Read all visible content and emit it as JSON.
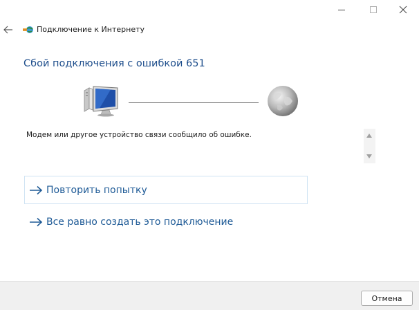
{
  "window": {
    "title": "Подключение к Интернету"
  },
  "heading": "Сбой подключения с ошибкой 651",
  "message": "Модем или другое устройство связи сообщило об ошибке.",
  "options": [
    {
      "label": "Повторить попытку"
    },
    {
      "label": "Все равно создать это подключение"
    }
  ],
  "footer": {
    "cancel_label": "Отмена"
  },
  "colors": {
    "heading": "#1e4e8c",
    "link": "#1e5a96",
    "accent_border": "#cfe3f3"
  },
  "icons": {
    "back": "back-arrow-icon",
    "app": "network-connection-icon",
    "computer": "computer-icon",
    "globe": "globe-icon"
  }
}
